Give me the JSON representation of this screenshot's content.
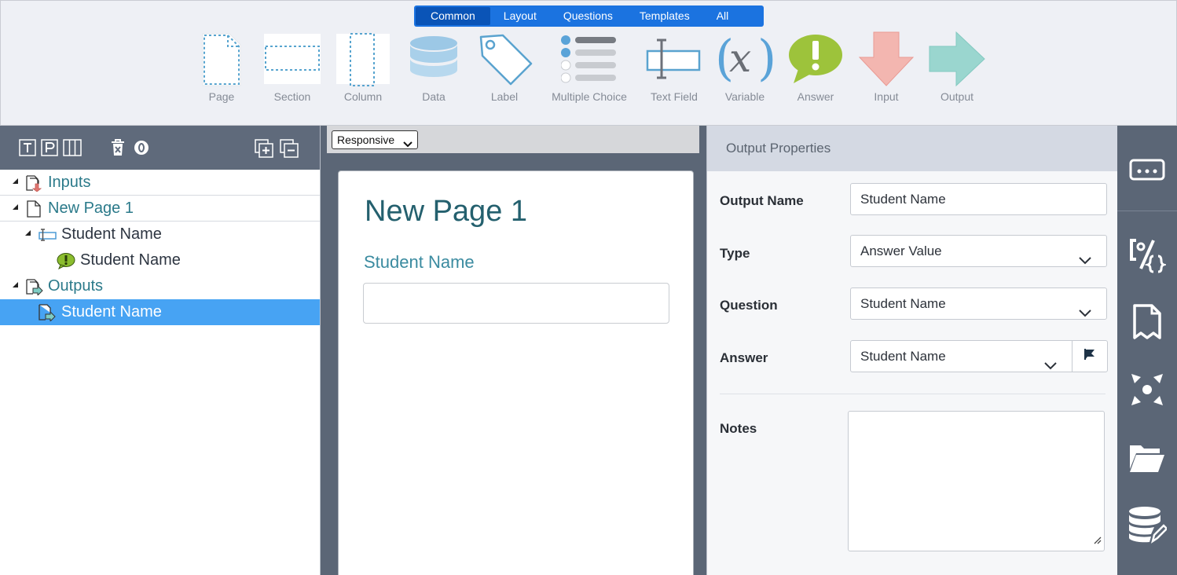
{
  "toolbar": {
    "tabs": [
      {
        "label": "Common",
        "active": true
      },
      {
        "label": "Layout"
      },
      {
        "label": "Questions"
      },
      {
        "label": "Templates"
      },
      {
        "label": "All"
      }
    ],
    "tools": [
      {
        "label": "Page",
        "icon": "page-icon"
      },
      {
        "label": "Section",
        "icon": "section-icon"
      },
      {
        "label": "Column",
        "icon": "column-icon"
      },
      {
        "label": "Data",
        "icon": "database-icon"
      },
      {
        "label": "Label",
        "icon": "tag-icon"
      },
      {
        "label": "Multiple Choice",
        "icon": "list-icon"
      },
      {
        "label": "Text Field",
        "icon": "text-field-icon"
      },
      {
        "label": "Variable",
        "icon": "variable-icon"
      },
      {
        "label": "Answer",
        "icon": "answer-bubble-icon"
      },
      {
        "label": "Input",
        "icon": "down-arrow-icon"
      },
      {
        "label": "Output",
        "icon": "right-arrow-icon"
      }
    ]
  },
  "tree": {
    "toolbar_icons": [
      "title-mode-icon",
      "page-mode-icon",
      "column-mode-icon",
      "trash-icon",
      "toggle-icon",
      "expand-all-icon",
      "collapse-all-icon"
    ],
    "rows": [
      {
        "label": "Inputs"
      },
      {
        "label": "New Page 1"
      },
      {
        "label": "Student Name"
      },
      {
        "label": "Student Name"
      },
      {
        "label": "Outputs"
      },
      {
        "label": "Student Name",
        "selected": true
      }
    ]
  },
  "canvas": {
    "view_select": "Responsive",
    "page_title": "New Page 1",
    "field_label": "Student Name"
  },
  "properties": {
    "title": "Output Properties",
    "output_name_label": "Output Name",
    "output_name_value": "Student Name",
    "type_label": "Type",
    "type_value": "Answer Value",
    "question_label": "Question",
    "question_value": "Student Name",
    "answer_label": "Answer",
    "answer_value": "Student Name",
    "notes_label": "Notes",
    "notes_value": ""
  },
  "sidebar": {
    "items": [
      "field-properties-icon",
      "variables-icon",
      "bookmark-icon",
      "navigation-icon",
      "folder-icon",
      "database-edit-icon"
    ]
  },
  "colors": {
    "accent": "#1b73e0",
    "selected_row": "#47a3f3",
    "panel_dark": "#5b6676",
    "teal_text": "#2b7a8a"
  }
}
